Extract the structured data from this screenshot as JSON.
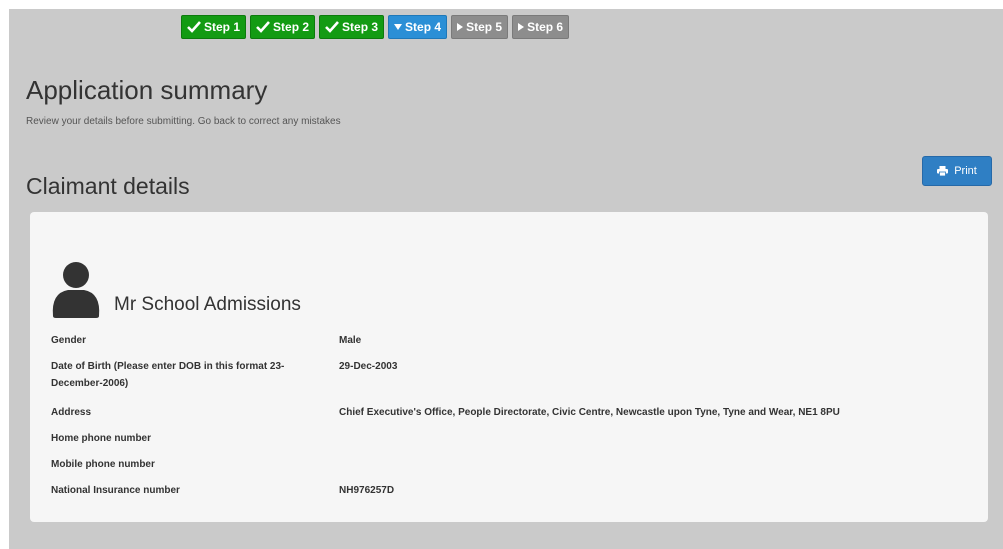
{
  "steps": [
    {
      "label": "Step 1",
      "status": "done"
    },
    {
      "label": "Step 2",
      "status": "done"
    },
    {
      "label": "Step 3",
      "status": "done"
    },
    {
      "label": "Step 4",
      "status": "current"
    },
    {
      "label": "Step 5",
      "status": "future"
    },
    {
      "label": "Step 6",
      "status": "future"
    }
  ],
  "page": {
    "title": "Application summary",
    "subtitle": "Review your details before submitting. Go back to correct any mistakes"
  },
  "print_button": {
    "label": "Print",
    "icon": "printer-icon"
  },
  "section": {
    "title": "Claimant details"
  },
  "claimant": {
    "name": "Mr School Admissions",
    "avatar_icon": "user-icon",
    "fields": [
      {
        "label": "Gender",
        "value": "Male"
      },
      {
        "label": "Date of Birth (Please enter DOB in this format 23-December-2006)",
        "value": "29-Dec-2003"
      },
      {
        "label": "Address",
        "value": "Chief Executive's Office, People Directorate, Civic Centre, Newcastle upon Tyne, Tyne and Wear, NE1 8PU"
      },
      {
        "label": "Home phone number",
        "value": ""
      },
      {
        "label": "Mobile phone number",
        "value": ""
      },
      {
        "label": "National Insurance number",
        "value": "NH976257D"
      }
    ]
  },
  "colors": {
    "step_done": "#139b13",
    "step_current": "#2b8fd6",
    "step_future": "#8d8d8d",
    "print_button": "#2f7fc4",
    "page_background": "#cacaca",
    "panel_background": "#f6f6f6"
  }
}
